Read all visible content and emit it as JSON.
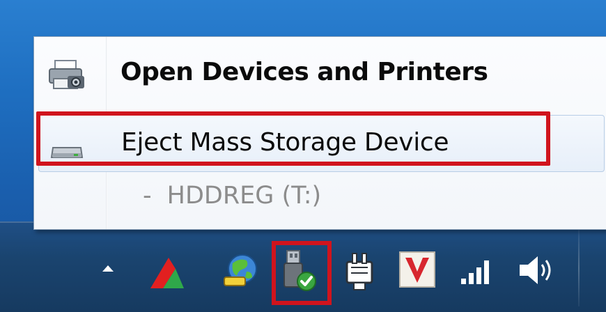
{
  "menu": {
    "items": [
      {
        "label": "Open Devices and Printers",
        "icon": "printer-icon"
      },
      {
        "label": "Eject Mass Storage Device",
        "icon": "removable-drive-icon",
        "highlighted": true
      },
      {
        "label": "HDDREG (T:)",
        "prefix": "-"
      }
    ]
  },
  "tray": {
    "icons": [
      "show-hidden-icons-up-arrow-icon",
      "red-green-app-icon",
      "globe-network-app-icon",
      "safely-remove-hardware-icon",
      "power-plug-icon",
      "v-app-icon",
      "network-signal-icon",
      "volume-icon"
    ]
  },
  "annotations": {
    "highlight_color": "#d0141d",
    "highlighted": [
      "eject-mass-storage-menu-item",
      "safely-remove-hardware-icon"
    ]
  },
  "colors": {
    "desktop": "#1e6ec0",
    "taskbar": "#1a446f",
    "menu_background": "#f7f9fc",
    "hover_item": "#e7eff9"
  }
}
